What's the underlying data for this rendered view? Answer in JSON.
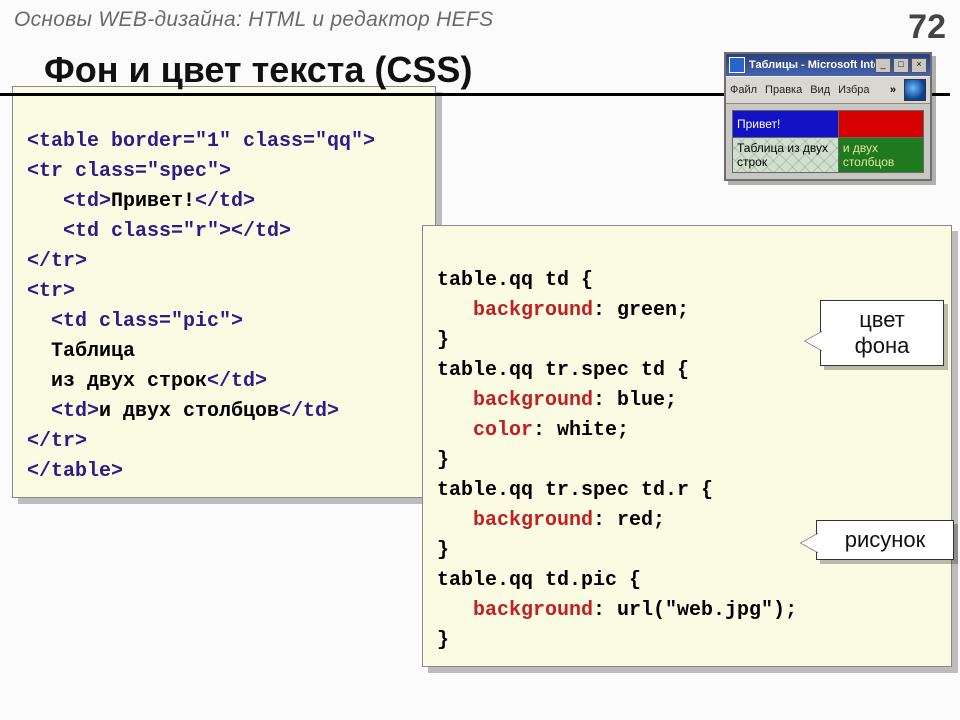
{
  "header": {
    "course": "Основы WEB-дизайна: HTML и редактор HEFS",
    "page_number": "72"
  },
  "topic": "Фон и цвет текста (CSS)",
  "html_code": {
    "l1a": "<table border=\"1\" class=\"qq\">",
    "l2": "<tr class=\"spec\">",
    "l3a": "   <td>",
    "l3b": "Привет!",
    "l3c": "</td>",
    "l4": "   <td class=\"r\"></td>",
    "l5": "</tr>",
    "l6": "<tr>",
    "l7": "  <td class=\"pic\">",
    "l8": "  Таблица",
    "l9a": "  из двух строк",
    "l9b": "</td>",
    "l10a": "  <td>",
    "l10b": "и двух столбцов",
    "l10c": "</td>",
    "l11": "</tr>",
    "l12": "</table>"
  },
  "css_code": {
    "s1": "table.qq td {",
    "p1": "   background",
    "v1": ": green;",
    "b1": "}",
    "s2": "table.qq tr.spec td {",
    "p2": "   background",
    "v2": ": blue;",
    "p3": "   color",
    "v3": ": white;",
    "b2": "}",
    "s3": "table.qq tr.spec td.r {",
    "p4": "   background",
    "v4": ": red;",
    "b3": "}",
    "s4": "table.qq td.pic {",
    "p5": "   background",
    "v5": ": url(\"web.jpg\");",
    "b4": "}"
  },
  "browser": {
    "title": "Таблицы - Microsoft Intern…",
    "menu": [
      "Файл",
      "Правка",
      "Вид",
      "Избра"
    ],
    "chev": "»",
    "cells": {
      "hello": "Привет!",
      "pic": "Таблица из двух строк",
      "g": "и двух столбцов"
    }
  },
  "callouts": {
    "c1": "цвет фона",
    "c2": "рисунок"
  }
}
